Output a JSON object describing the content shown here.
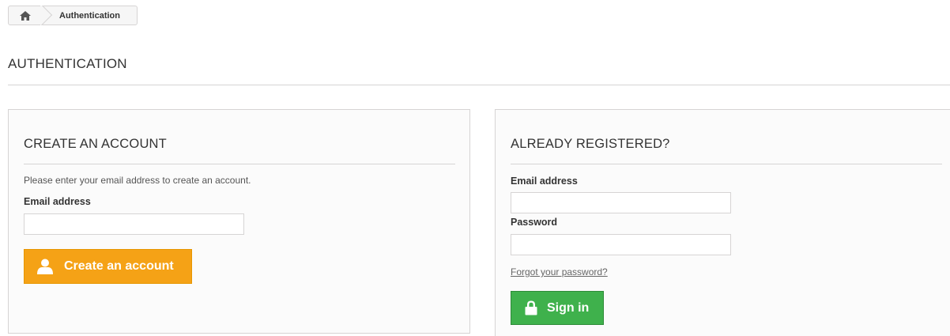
{
  "breadcrumb": {
    "home_icon": "home-icon",
    "current": "Authentication"
  },
  "page": {
    "heading": "AUTHENTICATION"
  },
  "create_account": {
    "title": "CREATE AN ACCOUNT",
    "description": "Please enter your email address to create an account.",
    "email_label": "Email address",
    "email_value": "",
    "button_label": "Create an account",
    "button_icon": "user-icon",
    "button_color": "#f5a216"
  },
  "login": {
    "title": "ALREADY REGISTERED?",
    "email_label": "Email address",
    "email_value": "",
    "password_label": "Password",
    "password_value": "",
    "forgot_link": "Forgot your password?",
    "button_label": "Sign in",
    "button_icon": "lock-icon",
    "button_color": "#3fb14c"
  }
}
